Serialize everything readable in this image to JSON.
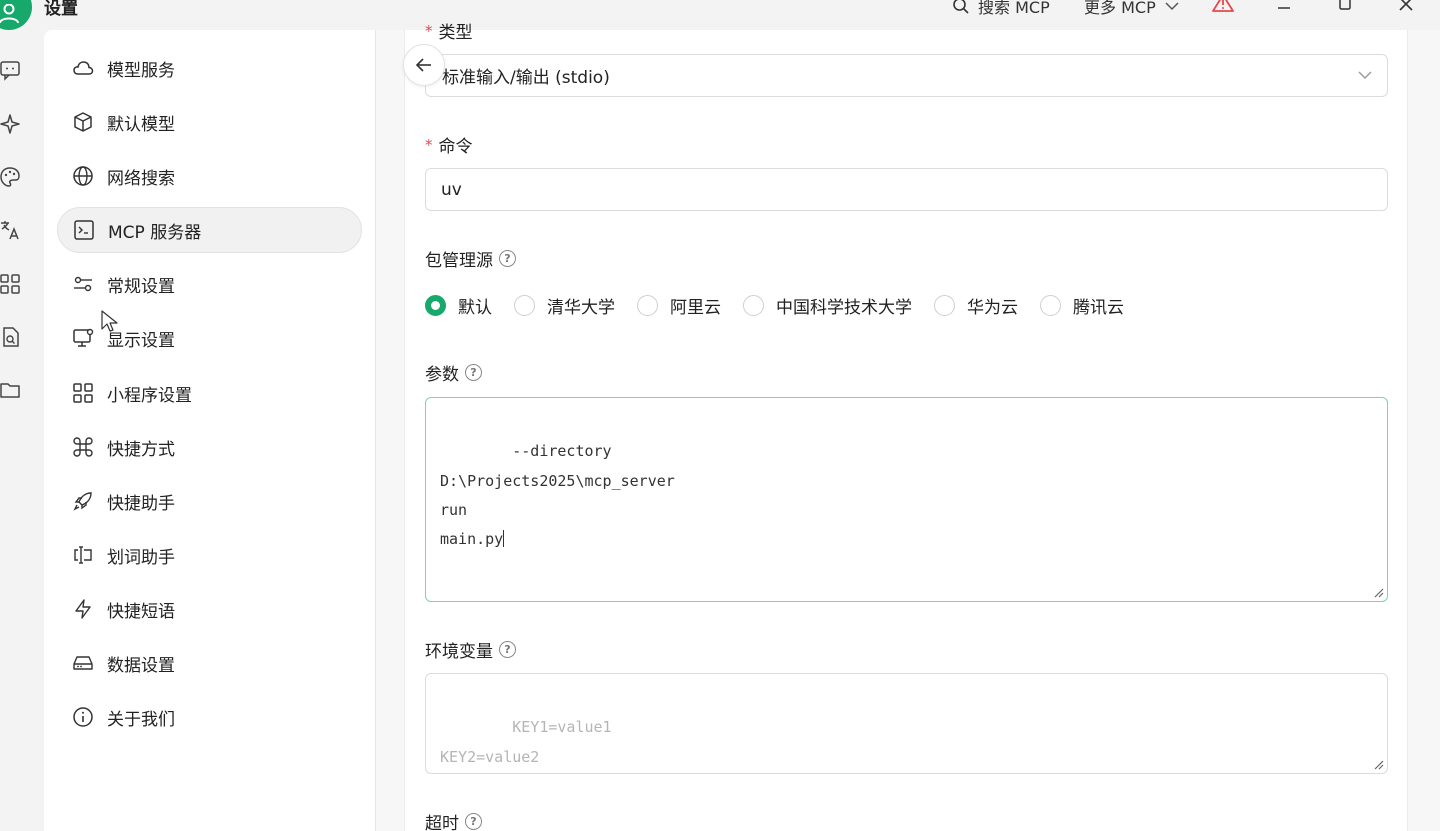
{
  "app": {
    "title": "设置"
  },
  "titlebar": {
    "search_mcp": "搜索 MCP",
    "more_mcp": "更多 MCP"
  },
  "rail": {
    "items": [
      "chat-icon",
      "sparkle-icon",
      "palette-icon",
      "translate-icon",
      "apps-icon",
      "file-search-icon",
      "folder-icon"
    ]
  },
  "nav": {
    "items": [
      {
        "label": "模型服务",
        "icon": "cloud-icon"
      },
      {
        "label": "默认模型",
        "icon": "cube-icon"
      },
      {
        "label": "网络搜索",
        "icon": "globe-icon"
      },
      {
        "label": "MCP 服务器",
        "icon": "terminal-icon",
        "active": true
      },
      {
        "label": "常规设置",
        "icon": "sliders-icon"
      },
      {
        "label": "显示设置",
        "icon": "monitor-icon"
      },
      {
        "label": "小程序设置",
        "icon": "grid-icon"
      },
      {
        "label": "快捷方式",
        "icon": "command-icon"
      },
      {
        "label": "快捷助手",
        "icon": "rocket-icon"
      },
      {
        "label": "划词助手",
        "icon": "text-select-icon"
      },
      {
        "label": "快捷短语",
        "icon": "zap-icon"
      },
      {
        "label": "数据设置",
        "icon": "hard-drive-icon"
      },
      {
        "label": "关于我们",
        "icon": "info-icon"
      }
    ]
  },
  "form": {
    "type_label": "类型",
    "type_value": "标准输入/输出 (stdio)",
    "command_label": "命令",
    "command_value": "uv",
    "registry_label": "包管理源",
    "registry_options": [
      "默认",
      "清华大学",
      "阿里云",
      "中国科学技术大学",
      "华为云",
      "腾讯云"
    ],
    "registry_selected": "默认",
    "args_label": "参数",
    "args_value": "--directory\nD:\\Projects2025\\mcp_server\nrun\nmain.py",
    "env_label": "环境变量",
    "env_placeholder": "KEY1=value1\nKEY2=value2",
    "timeout_label": "超时"
  },
  "colors": {
    "accent": "#17a86b",
    "required": "#e5484d",
    "focus_border": "#7fd3ae",
    "warning": "#e5484d"
  }
}
